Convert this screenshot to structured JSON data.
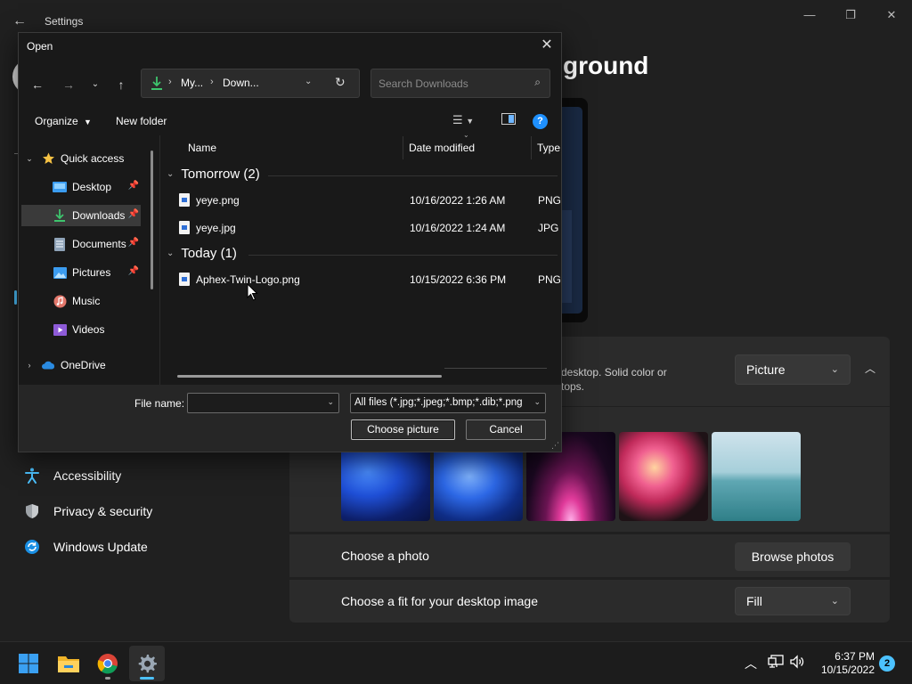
{
  "settings": {
    "title": "Settings",
    "page_title": "ground",
    "nav": [
      {
        "label": "Accessibility",
        "icon": "accessibility-icon"
      },
      {
        "label": "Privacy & security",
        "icon": "shield-icon"
      },
      {
        "label": "Windows Update",
        "icon": "update-icon"
      }
    ],
    "personalize": {
      "desc_line1": "desktop. Solid color or",
      "desc_line2": "tops.",
      "dropdown_value": "Picture"
    },
    "choose_photo": {
      "label": "Choose a photo",
      "button": "Browse photos"
    },
    "choose_fit": {
      "label": "Choose a fit for your desktop image",
      "value": "Fill"
    }
  },
  "dialog": {
    "title": "Open",
    "breadcrumb": [
      "My...",
      "Down..."
    ],
    "search_placeholder": "Search Downloads",
    "toolbar": {
      "organize": "Organize",
      "new_folder": "New folder"
    },
    "nav_pane": [
      {
        "label": "Quick access",
        "level": 0,
        "expanded": true,
        "icon": "star-icon"
      },
      {
        "label": "Desktop",
        "level": 1,
        "pinned": true,
        "icon": "desktop-folder-icon"
      },
      {
        "label": "Downloads",
        "level": 1,
        "pinned": true,
        "selected": true,
        "icon": "downloads-folder-icon"
      },
      {
        "label": "Documents",
        "level": 1,
        "pinned": true,
        "icon": "documents-folder-icon"
      },
      {
        "label": "Pictures",
        "level": 1,
        "pinned": true,
        "icon": "pictures-folder-icon"
      },
      {
        "label": "Music",
        "level": 1,
        "icon": "music-folder-icon"
      },
      {
        "label": "Videos",
        "level": 1,
        "icon": "videos-folder-icon"
      },
      {
        "label": "OneDrive",
        "level": 0,
        "expanded": false,
        "icon": "onedrive-icon"
      }
    ],
    "columns": {
      "name": "Name",
      "date": "Date modified",
      "type": "Type"
    },
    "groups": [
      {
        "label": "Tomorrow (2)",
        "files": [
          {
            "name": "yeye.png",
            "date": "10/16/2022 1:26 AM",
            "type": "PNG"
          },
          {
            "name": "yeye.jpg",
            "date": "10/16/2022 1:24 AM",
            "type": "JPG F"
          }
        ]
      },
      {
        "label": "Today (1)",
        "files": [
          {
            "name": "Aphex-Twin-Logo.png",
            "date": "10/15/2022 6:36 PM",
            "type": "PNG"
          }
        ]
      }
    ],
    "footer": {
      "file_name_label": "File name:",
      "file_name_value": "",
      "filter": "All files (*.jpg;*.jpeg;*.bmp;*.dib;*.png",
      "choose_button": "Choose picture",
      "cancel_button": "Cancel"
    }
  },
  "taskbar": {
    "time": "6:37 PM",
    "date": "10/15/2022",
    "notifications": "2"
  },
  "colors": {
    "accent": "#4cc2ff",
    "help": "#1e90ff",
    "background": "#202020"
  }
}
